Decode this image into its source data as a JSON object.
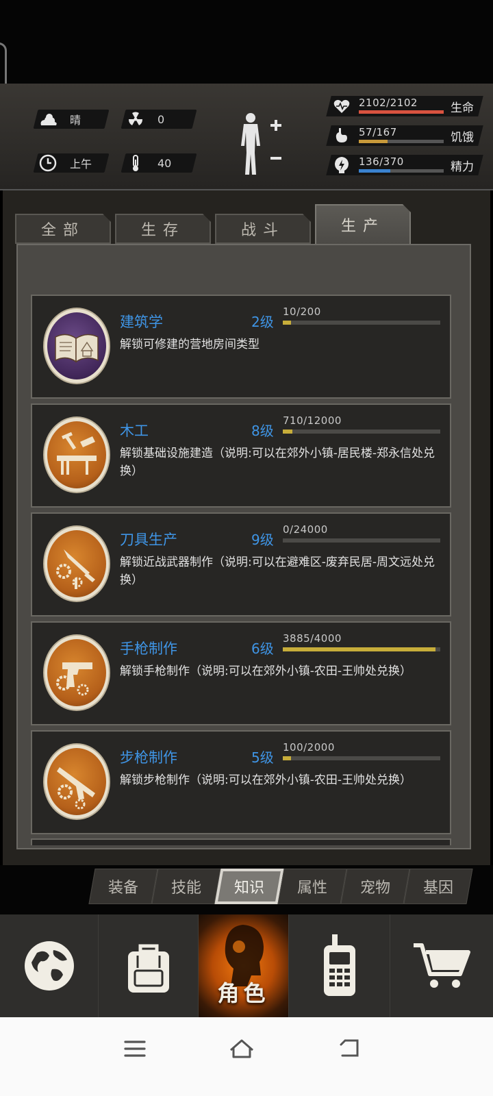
{
  "status": {
    "weather": "晴",
    "radiation": "0",
    "time_of_day": "上午",
    "temperature": "40"
  },
  "vitals": [
    {
      "label": "生命",
      "value": "2102/2102",
      "fraction": 1.0,
      "color": "#d9533f",
      "icon": "heart-icon"
    },
    {
      "label": "饥饿",
      "value": "57/167",
      "fraction": 0.34,
      "color": "#c89a3a",
      "icon": "stomach-icon"
    },
    {
      "label": "精力",
      "value": "136/370",
      "fraction": 0.37,
      "color": "#3a82cf",
      "icon": "energy-icon"
    }
  ],
  "tabs": [
    {
      "label": "全部",
      "active": false
    },
    {
      "label": "生存",
      "active": false
    },
    {
      "label": "战斗",
      "active": false
    },
    {
      "label": "生产",
      "active": true
    }
  ],
  "skills": [
    {
      "name": "建筑学",
      "level": "2级",
      "progress": "10/200",
      "fraction": 0.05,
      "description": "解锁可修建的营地房间类型",
      "icon": "book-icon",
      "style": "purple"
    },
    {
      "name": "木工",
      "level": "8级",
      "progress": "710/12000",
      "fraction": 0.06,
      "description": "解锁基础设施建造（说明:可以在郊外小镇-居民楼-郑永信处兑换）",
      "icon": "carpentry-icon",
      "style": "orange"
    },
    {
      "name": "刀具生产",
      "level": "9级",
      "progress": "0/24000",
      "fraction": 0.0,
      "description": "解锁近战武器制作（说明:可以在避难区-废弃民居-周文远处兑换）",
      "icon": "knife-icon",
      "style": "orange"
    },
    {
      "name": "手枪制作",
      "level": "6级",
      "progress": "3885/4000",
      "fraction": 0.97,
      "description": "解锁手枪制作（说明:可以在郊外小镇-农田-王帅处兑换）",
      "icon": "pistol-icon",
      "style": "orange"
    },
    {
      "name": "步枪制作",
      "level": "5级",
      "progress": "100/2000",
      "fraction": 0.05,
      "description": "解锁步枪制作（说明:可以在郊外小镇-农田-王帅处兑换）",
      "icon": "rifle-icon",
      "style": "orange"
    }
  ],
  "subtabs": [
    {
      "label": "装备",
      "active": false
    },
    {
      "label": "技能",
      "active": false
    },
    {
      "label": "知识",
      "active": true
    },
    {
      "label": "属性",
      "active": false
    },
    {
      "label": "宠物",
      "active": false
    },
    {
      "label": "基因",
      "active": false
    }
  ],
  "nav": {
    "items": [
      "map-icon",
      "backpack-icon",
      "character-icon",
      "radio-icon",
      "cart-icon"
    ],
    "character_label": "角色"
  }
}
